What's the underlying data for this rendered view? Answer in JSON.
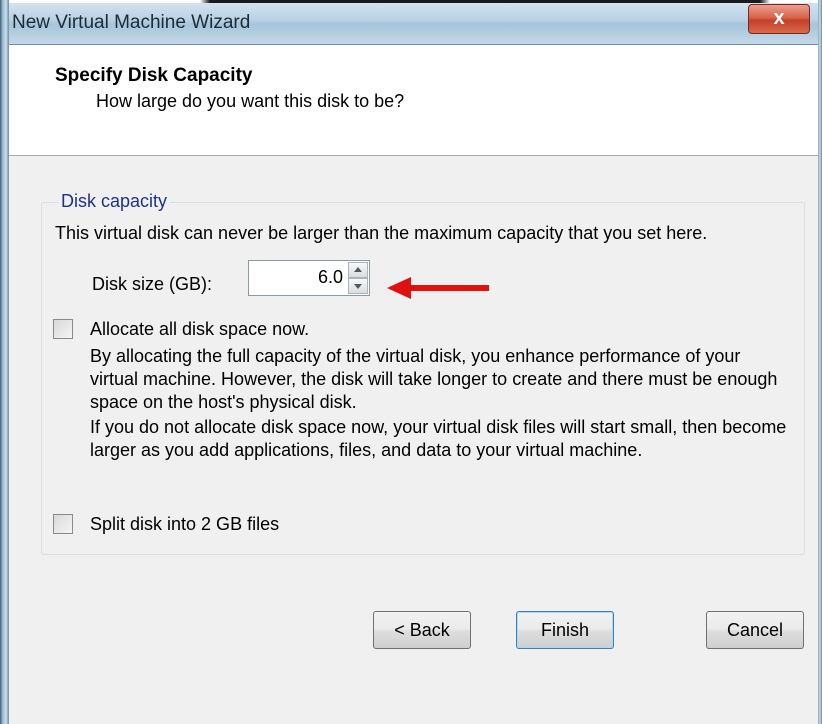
{
  "window": {
    "title": "New Virtual Machine Wizard",
    "close_label": "x"
  },
  "header": {
    "title": "Specify Disk Capacity",
    "subtitle": "How large do you want this disk to be?"
  },
  "group": {
    "label": "Disk capacity",
    "description": "This virtual disk can never be larger than the maximum capacity that you set here."
  },
  "disk_size": {
    "label": "Disk size (GB):",
    "value": "6.0"
  },
  "allocate": {
    "label": "Allocate all disk space now.",
    "checked": false,
    "paragraph1": "By allocating the full capacity of the virtual disk, you enhance performance of your virtual machine.  However, the disk will take longer to create and there must be enough space on the host's physical disk.",
    "paragraph2": "If you do not allocate disk space now, your virtual disk files will start small, then become larger as you add applications, files, and data to your virtual machine."
  },
  "split": {
    "label": "Split disk into 2 GB files",
    "checked": false
  },
  "buttons": {
    "back": "< Back",
    "finish": "Finish",
    "cancel": "Cancel"
  },
  "colors": {
    "arrow": "#e01010",
    "group_label": "#1e3287",
    "close_button": "#c24128"
  },
  "icons": {
    "annotation": "red-arrow-icon"
  }
}
